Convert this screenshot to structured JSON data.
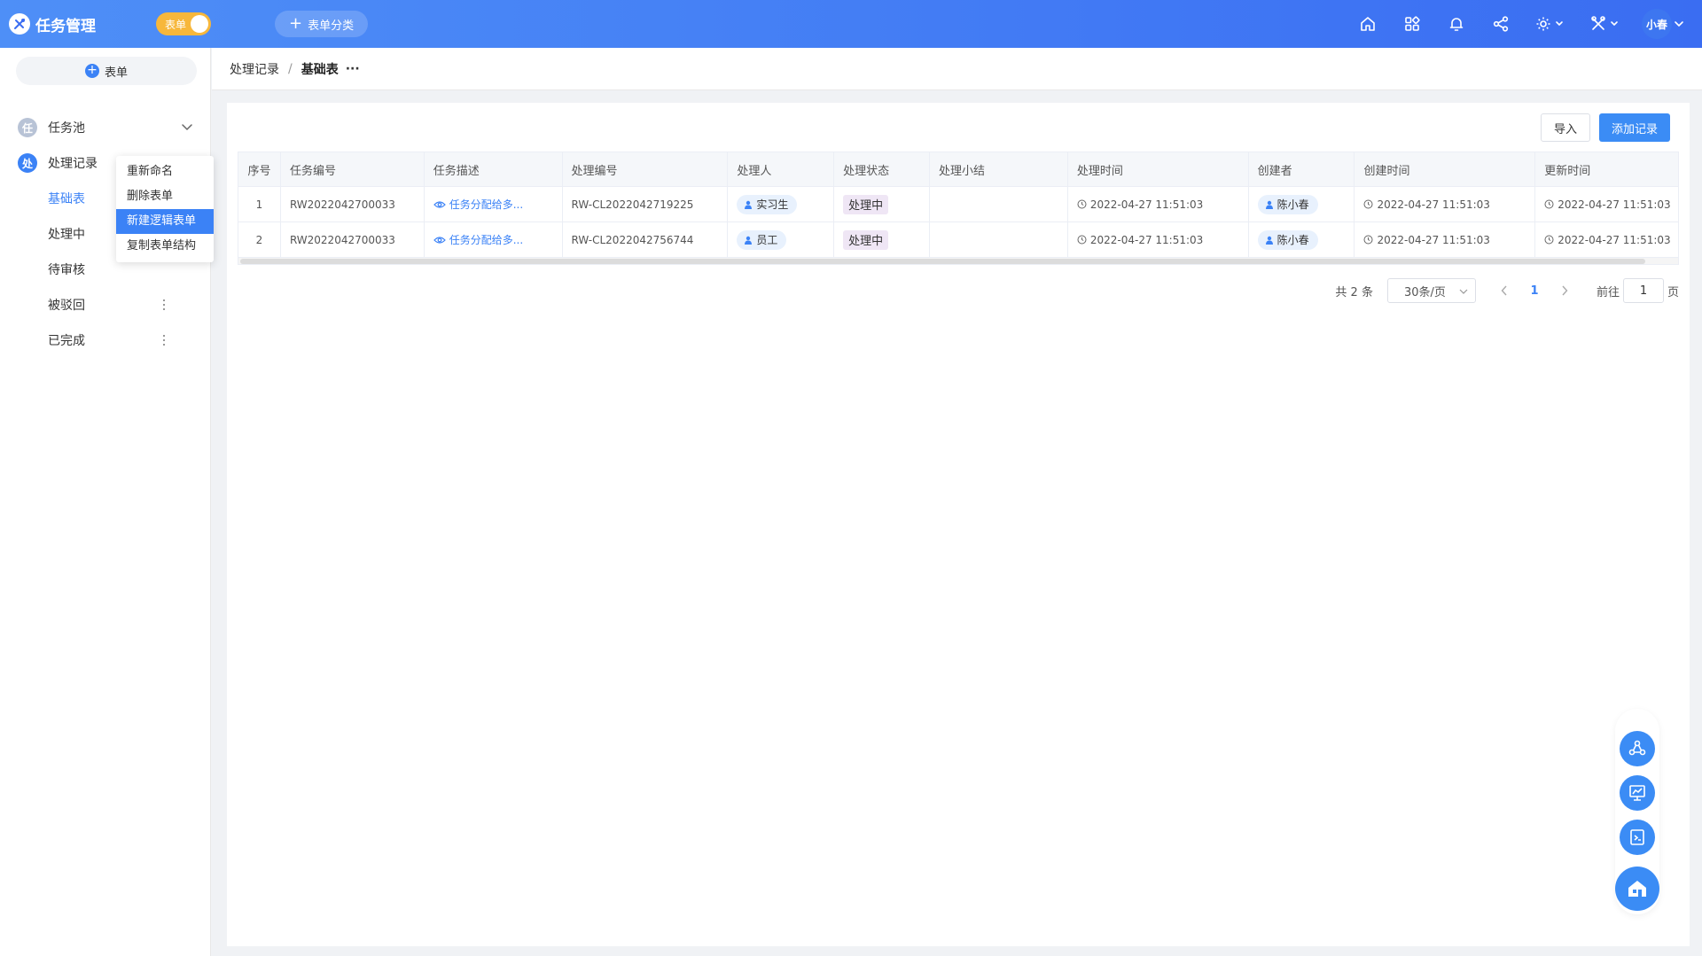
{
  "app": {
    "title": "任务管理",
    "mode_toggle_label": "表单",
    "category_button": "表单分类",
    "user_name": "小春"
  },
  "colors": {
    "accent": "#3b82f6",
    "topbar": "#3a6df2",
    "toggle": "#f7b73b",
    "badge_pool": "#b8c3d6",
    "badge_records": "#3b82f6"
  },
  "topbar_icons": [
    "home-icon",
    "apps-icon",
    "bell-icon",
    "share-icon",
    "settings-icon",
    "tools-icon"
  ],
  "sidebar": {
    "new_form_label": "表单",
    "groups": [
      {
        "badge": "任",
        "label": "任务池",
        "expanded": false
      },
      {
        "badge": "处",
        "label": "处理记录",
        "expanded": true
      }
    ],
    "sub_items": [
      {
        "label": "基础表",
        "active": true
      },
      {
        "label": "处理中",
        "active": false
      },
      {
        "label": "待审核",
        "active": false
      },
      {
        "label": "被驳回",
        "active": false
      },
      {
        "label": "已完成",
        "active": false
      }
    ],
    "context_menu": [
      {
        "label": "重新命名",
        "active": false
      },
      {
        "label": "删除表单",
        "active": false
      },
      {
        "label": "新建逻辑表单",
        "active": true
      },
      {
        "label": "复制表单结构",
        "active": false
      }
    ]
  },
  "breadcrumb": {
    "parent": "处理记录",
    "separator": "/",
    "current": "基础表",
    "more": "···"
  },
  "toolbar": {
    "import_label": "导入",
    "add_label": "添加记录"
  },
  "table": {
    "columns": [
      "序号",
      "任务编号",
      "任务描述",
      "处理编号",
      "处理人",
      "处理状态",
      "处理小结",
      "处理时间",
      "创建者",
      "创建时间",
      "更新时间"
    ],
    "rows": [
      {
        "index": "1",
        "task_no": "RW2022042700033",
        "description": "任务分配给多...",
        "process_no": "RW-CL2022042719225",
        "handler": "实习生",
        "status": "处理中",
        "summary": "",
        "process_time": "2022-04-27 11:51:03",
        "creator": "陈小春",
        "created": "2022-04-27 11:51:03",
        "updated": "2022-04-27 11:51:03"
      },
      {
        "index": "2",
        "task_no": "RW2022042700033",
        "description": "任务分配给多...",
        "process_no": "RW-CL2022042756744",
        "handler": "员工",
        "status": "处理中",
        "summary": "",
        "process_time": "2022-04-27 11:51:03",
        "creator": "陈小春",
        "created": "2022-04-27 11:51:03",
        "updated": "2022-04-27 11:51:03"
      }
    ]
  },
  "pagination": {
    "total_text": "共 2 条",
    "page_size": "30条/页",
    "current_page": "1",
    "goto_label": "前往",
    "goto_value": "1",
    "page_unit": "页"
  },
  "float_tools": [
    "workflow-icon",
    "dashboard-icon",
    "script-icon",
    "portal-icon"
  ]
}
